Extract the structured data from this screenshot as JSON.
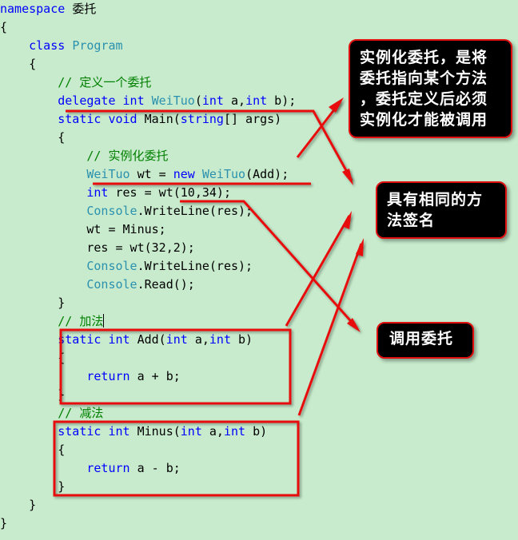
{
  "code": {
    "lines": [
      {
        "indent": "",
        "tokens": [
          {
            "t": "namespace ",
            "c": "kw"
          },
          {
            "t": "委托",
            "c": "tx cjk"
          }
        ]
      },
      {
        "indent": "",
        "tokens": [
          {
            "t": "{",
            "c": "tx"
          }
        ]
      },
      {
        "indent": "    ",
        "tokens": [
          {
            "t": "class ",
            "c": "kw"
          },
          {
            "t": "Program",
            "c": "ty"
          }
        ]
      },
      {
        "indent": "    ",
        "tokens": [
          {
            "t": "{",
            "c": "tx"
          }
        ]
      },
      {
        "indent": "        ",
        "tokens": [
          {
            "t": "// ",
            "c": "cm"
          },
          {
            "t": "定义一个委托",
            "c": "cm cjk"
          }
        ]
      },
      {
        "indent": "        ",
        "tokens": [
          {
            "t": "delegate int ",
            "c": "kw"
          },
          {
            "t": "WeiTuo",
            "c": "ty"
          },
          {
            "t": "(",
            "c": "tx"
          },
          {
            "t": "int",
            "c": "kw"
          },
          {
            "t": " a,",
            "c": "tx"
          },
          {
            "t": "int",
            "c": "kw"
          },
          {
            "t": " b);",
            "c": "tx"
          }
        ]
      },
      {
        "indent": "        ",
        "tokens": [
          {
            "t": "static void ",
            "c": "kw"
          },
          {
            "t": "Main(",
            "c": "tx"
          },
          {
            "t": "string",
            "c": "kw"
          },
          {
            "t": "[] args)",
            "c": "tx"
          }
        ]
      },
      {
        "indent": "        ",
        "tokens": [
          {
            "t": "{",
            "c": "tx"
          }
        ]
      },
      {
        "indent": "            ",
        "tokens": [
          {
            "t": "// ",
            "c": "cm"
          },
          {
            "t": "实例化委托",
            "c": "cm cjk"
          }
        ]
      },
      {
        "indent": "            ",
        "tokens": [
          {
            "t": "WeiTuo",
            "c": "ty"
          },
          {
            "t": " wt = ",
            "c": "tx"
          },
          {
            "t": "new ",
            "c": "kw"
          },
          {
            "t": "WeiTuo",
            "c": "ty"
          },
          {
            "t": "(Add);",
            "c": "tx"
          }
        ]
      },
      {
        "indent": "            ",
        "tokens": [
          {
            "t": "int",
            "c": "kw"
          },
          {
            "t": " res = wt(10,34);",
            "c": "tx"
          }
        ]
      },
      {
        "indent": "            ",
        "tokens": [
          {
            "t": "Console",
            "c": "ty"
          },
          {
            "t": ".WriteLine(res);",
            "c": "tx"
          }
        ]
      },
      {
        "indent": "            ",
        "tokens": [
          {
            "t": "wt = Minus;",
            "c": "tx"
          }
        ]
      },
      {
        "indent": "            ",
        "tokens": [
          {
            "t": "res = wt(32,2);",
            "c": "tx"
          }
        ]
      },
      {
        "indent": "            ",
        "tokens": [
          {
            "t": "Console",
            "c": "ty"
          },
          {
            "t": ".WriteLine(res);",
            "c": "tx"
          }
        ]
      },
      {
        "indent": "            ",
        "tokens": [
          {
            "t": "Console",
            "c": "ty"
          },
          {
            "t": ".Read();",
            "c": "tx"
          }
        ]
      },
      {
        "indent": "        ",
        "tokens": [
          {
            "t": "}",
            "c": "tx"
          }
        ]
      },
      {
        "indent": "        ",
        "tokens": [
          {
            "t": "// ",
            "c": "cm"
          },
          {
            "t": "加法",
            "c": "cm cjk"
          }
        ],
        "caret": true
      },
      {
        "indent": "        ",
        "tokens": [
          {
            "t": "static int ",
            "c": "kw"
          },
          {
            "t": "Add(",
            "c": "tx"
          },
          {
            "t": "int",
            "c": "kw"
          },
          {
            "t": " a,",
            "c": "tx"
          },
          {
            "t": "int",
            "c": "kw"
          },
          {
            "t": " b)",
            "c": "tx"
          }
        ]
      },
      {
        "indent": "        ",
        "tokens": [
          {
            "t": "{",
            "c": "tx"
          }
        ]
      },
      {
        "indent": "            ",
        "tokens": [
          {
            "t": "return ",
            "c": "kw"
          },
          {
            "t": "a + b;",
            "c": "tx"
          }
        ]
      },
      {
        "indent": "        ",
        "tokens": [
          {
            "t": "}",
            "c": "tx"
          }
        ]
      },
      {
        "indent": "        ",
        "tokens": [
          {
            "t": "// ",
            "c": "cm"
          },
          {
            "t": "减法",
            "c": "cm cjk"
          }
        ]
      },
      {
        "indent": "        ",
        "tokens": [
          {
            "t": "static int ",
            "c": "kw"
          },
          {
            "t": "Minus(",
            "c": "tx"
          },
          {
            "t": "int",
            "c": "kw"
          },
          {
            "t": " a,",
            "c": "tx"
          },
          {
            "t": "int",
            "c": "kw"
          },
          {
            "t": " b)",
            "c": "tx"
          }
        ]
      },
      {
        "indent": "        ",
        "tokens": [
          {
            "t": "{",
            "c": "tx"
          }
        ]
      },
      {
        "indent": "            ",
        "tokens": [
          {
            "t": "return ",
            "c": "kw"
          },
          {
            "t": "a - b;",
            "c": "tx"
          }
        ]
      },
      {
        "indent": "        ",
        "tokens": [
          {
            "t": "}",
            "c": "tx"
          }
        ]
      },
      {
        "indent": "    ",
        "tokens": [
          {
            "t": "}",
            "c": "tx"
          }
        ]
      },
      {
        "indent": "",
        "tokens": [
          {
            "t": "}",
            "c": "tx"
          }
        ]
      }
    ]
  },
  "annotations": {
    "note1": {
      "lines": [
        "实例化委托，是将",
        "委托指向某个方法",
        "，委托定义后必须",
        "实例化才能被调用"
      ]
    },
    "note2": {
      "lines": [
        "具有相同的方",
        "法签名"
      ]
    },
    "note3": {
      "lines": [
        "调用委托"
      ]
    }
  },
  "colors": {
    "background": "#c7ebcc",
    "keyword": "#0000ff",
    "type": "#2b91af",
    "comment": "#008000",
    "annotation_red": "#e81010",
    "note_bg": "#000000",
    "note_text": "#ffffff"
  }
}
